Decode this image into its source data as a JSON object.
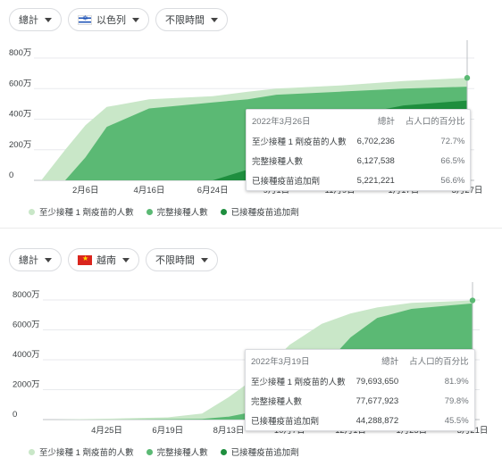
{
  "colors": {
    "first_dose": "#c9e7c8",
    "full": "#5bb974",
    "booster": "#1e8e3e",
    "grid": "#e8eaed",
    "axis_text": "#3c4043"
  },
  "legend": [
    "至少接種 1 劑疫苗的人數",
    "完整接種人數",
    "已接種疫苗追加劑"
  ],
  "panels": [
    {
      "chips": {
        "metric": "總計",
        "country": "以色列",
        "range": "不限時間"
      },
      "country_flag_icon": "israel-flag-icon",
      "tooltip": {
        "date": "2022年3月26日",
        "col_total": "總計",
        "col_pct": "占人口的百分比",
        "rows": [
          {
            "label": "至少接種 1 劑疫苗的人數",
            "value": "6,702,236",
            "pct": "72.7%"
          },
          {
            "label": "完整接種人數",
            "value": "6,127,538",
            "pct": "66.5%"
          },
          {
            "label": "已接種疫苗追加劑",
            "value": "5,221,221",
            "pct": "56.6%"
          }
        ]
      },
      "chart_data": {
        "type": "area",
        "y_ticks": [
          "0",
          "200万",
          "400万",
          "600万",
          "800万"
        ],
        "x_ticks": [
          "2月6日",
          "4月16日",
          "6月24日",
          "9月1日",
          "11月9日",
          "1月17日",
          "3月27日"
        ],
        "ylim": [
          0,
          8000000
        ],
        "x_dates": [
          "2020-12-20",
          "2021-01-15",
          "2021-02-06",
          "2021-03-01",
          "2021-04-16",
          "2021-06-24",
          "2021-08-01",
          "2021-09-01",
          "2021-11-09",
          "2022-01-17",
          "2022-03-27"
        ],
        "series": [
          {
            "name": "至少接種 1 劑疫苗的人數",
            "values": [
              0,
              2000000,
              3600000,
              4800000,
              5300000,
              5500000,
              5800000,
              6000000,
              6200000,
              6500000,
              6702236
            ]
          },
          {
            "name": "完整接種人數",
            "values": [
              0,
              0,
              1500000,
              3500000,
              4700000,
              5100000,
              5300000,
              5600000,
              5800000,
              6000000,
              6127538
            ]
          },
          {
            "name": "已接種疫苗追加劑",
            "values": [
              0,
              0,
              0,
              0,
              0,
              0,
              700000,
              2800000,
              4100000,
              4900000,
              5221221
            ]
          }
        ]
      }
    },
    {
      "chips": {
        "metric": "總計",
        "country": "越南",
        "range": "不限時間"
      },
      "country_flag_icon": "vietnam-flag-icon",
      "tooltip": {
        "date": "2022年3月19日",
        "col_total": "總計",
        "col_pct": "占人口的百分比",
        "rows": [
          {
            "label": "至少接種 1 劑疫苗的人數",
            "value": "79,693,650",
            "pct": "81.9%"
          },
          {
            "label": "完整接種人數",
            "value": "77,677,923",
            "pct": "79.8%"
          },
          {
            "label": "已接種疫苗追加劑",
            "value": "44,288,872",
            "pct": "45.5%"
          }
        ]
      },
      "chart_data": {
        "type": "area",
        "y_ticks": [
          "0",
          "2000万",
          "4000万",
          "6000万",
          "8000万"
        ],
        "x_ticks": [
          "4月25日",
          "6月19日",
          "8月13日",
          "10月7日",
          "12月1日",
          "1月25日",
          "3月21日"
        ],
        "ylim": [
          0,
          80000000
        ],
        "x_dates": [
          "2021-03-08",
          "2021-04-25",
          "2021-06-19",
          "2021-07-20",
          "2021-08-13",
          "2021-09-10",
          "2021-10-07",
          "2021-11-05",
          "2021-12-01",
          "2021-12-25",
          "2022-01-25",
          "2022-03-21"
        ],
        "series": [
          {
            "name": "至少接種 1 劑疫苗的人數",
            "values": [
              0,
              600000,
              1500000,
              4000000,
              15000000,
              30000000,
              50000000,
              64000000,
              71000000,
              75000000,
              78000000,
              79693650
            ]
          },
          {
            "name": "完整接種人數",
            "values": [
              0,
              0,
              300000,
              500000,
              2000000,
              6000000,
              18000000,
              34000000,
              55000000,
              68000000,
              74000000,
              77677923
            ]
          },
          {
            "name": "已接種疫苗追加劑",
            "values": [
              0,
              0,
              0,
              0,
              0,
              0,
              0,
              0,
              0,
              500000,
              18000000,
              44288872
            ]
          }
        ]
      }
    }
  ]
}
